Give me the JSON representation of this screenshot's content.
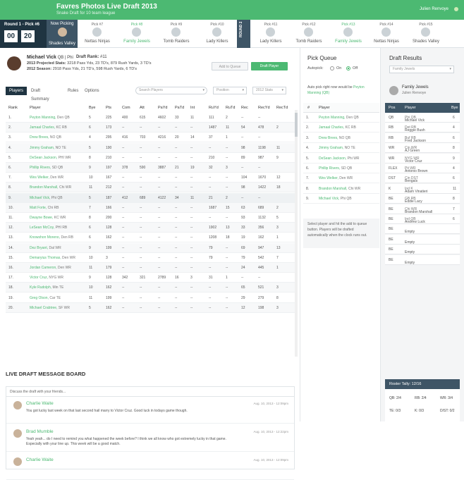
{
  "header": {
    "title": "Favres Photos Live Draft 2013",
    "subtitle": "Snake Draft for 10 team league",
    "user": "Julien Renvoye"
  },
  "round": {
    "label": "Round 1 - Pick #6",
    "clock_min": "00",
    "clock_sec": "20"
  },
  "now_picking": {
    "label": "Now Picking",
    "team": "Shades Valley"
  },
  "picks": [
    {
      "pick": "Pick #7",
      "team": "Nettas Ninjas",
      "green": false
    },
    {
      "pick": "Pick #8",
      "team": "Family Jewels",
      "green": true
    },
    {
      "pick": "Pick #9",
      "team": "Tomb Raiders",
      "green": false
    },
    {
      "pick": "Pick #10",
      "team": "Lady Killers",
      "green": false
    },
    {
      "pick": "Pick #11",
      "team": "Lady Killers",
      "green": false
    },
    {
      "pick": "Pick #12",
      "team": "Tomb Raiders",
      "green": false
    },
    {
      "pick": "Pick #13",
      "team": "Family Jewels",
      "green": true
    },
    {
      "pick": "Pick #14",
      "team": "Nettas Ninjas",
      "green": false
    },
    {
      "pick": "Pick #15",
      "team": "Shades Valley",
      "green": false
    }
  ],
  "round2_label": "ROUND 2",
  "player": {
    "name": "Michael Vick",
    "meta": "QB | Phi",
    "rank_label": "Draft Rank:",
    "rank": "#11",
    "stat1_label": "2013 Projected Stats:",
    "stat1": "3218 Pass Yds, 23 TD's, 879 Rush Yards, 3 TD's",
    "stat2_label": "2012 Season:",
    "stat2": "2918 Pass Yds, 21 TD's, 598 Rush Yards, 6 TD's",
    "add_queue": "Add to Queue",
    "draft_player": "Draft Player"
  },
  "tabs": [
    "Players",
    "Draft Summary",
    "Rules",
    "Options"
  ],
  "search_placeholder": "Search Players",
  "position_select": "Position",
  "stats_select": "2012 Stats",
  "table": {
    "headers": [
      "Rank",
      "Player",
      "Bye",
      "Pts",
      "Com",
      "Att",
      "PaYd",
      "PaTd",
      "Int",
      "RuYd",
      "RuTd",
      "Rec",
      "RecYd",
      "RecTd"
    ],
    "rows": [
      [
        "1.",
        "Peyton Manning,",
        "Den QB",
        "5",
        "225",
        "400",
        "615",
        "4602",
        "33",
        "11",
        "111",
        "2",
        "--",
        "--"
      ],
      [
        "2.",
        "Jamaal Charles,",
        "KC RB",
        "6",
        "173",
        "--",
        "--",
        "--",
        "--",
        "--",
        "1487",
        "11",
        "54",
        "478",
        "2"
      ],
      [
        "3.",
        "Drew Brees,",
        "NO QB",
        "4",
        "295",
        "416",
        "703",
        "4216",
        "20",
        "14",
        "37",
        "1",
        "--",
        "--"
      ],
      [
        "4.",
        "Jimmy Graham,",
        "NO TE",
        "5",
        "190",
        "--",
        "--",
        "--",
        "--",
        "--",
        "--",
        "--",
        "98",
        "1198",
        "11"
      ],
      [
        "5.",
        "DeSean Jackson,",
        "PHI WR",
        "8",
        "210",
        "--",
        "--",
        "--",
        "--",
        "--",
        "210",
        "--",
        "89",
        "987",
        "9"
      ],
      [
        "6.",
        "Phillip Rivers,",
        "SD QB",
        "9",
        "197",
        "378",
        "590",
        "3887",
        "21",
        "19",
        "32",
        "3",
        "--",
        "--"
      ],
      [
        "7.",
        "Wes Welker,",
        "Den WR",
        "10",
        "167",
        "--",
        "--",
        "--",
        "--",
        "--",
        "--",
        "--",
        "104",
        "1670",
        "12"
      ],
      [
        "8.",
        "Brandon Marshall,",
        "Chi WR",
        "11",
        "212",
        "--",
        "--",
        "--",
        "--",
        "--",
        "--",
        "--",
        "98",
        "1422",
        "18"
      ],
      [
        "9.",
        "Michael Vick,",
        "Phi QB",
        "5",
        "187",
        "412",
        "689",
        "4122",
        "34",
        "11",
        "21",
        "2",
        "--",
        "--"
      ],
      [
        "10.",
        "Matt Forte,",
        "Chi RB",
        "7",
        "166",
        "--",
        "--",
        "--",
        "--",
        "--",
        "1687",
        "15",
        "63",
        "689",
        "2"
      ],
      [
        "11.",
        "Dwayne Bowe,",
        "KC WR",
        "8",
        "200",
        "--",
        "--",
        "--",
        "--",
        "--",
        "--",
        "--",
        "93",
        "1132",
        "5"
      ],
      [
        "12.",
        "LeSean McCoy,",
        "PHI RB",
        "6",
        "128",
        "--",
        "--",
        "--",
        "--",
        "--",
        "1902",
        "13",
        "33",
        "356",
        "3"
      ],
      [
        "13.",
        "Knowshon Moreno,",
        "Den RB",
        "6",
        "162",
        "--",
        "--",
        "--",
        "--",
        "--",
        "1208",
        "18",
        "19",
        "162",
        "1"
      ],
      [
        "14.",
        "Dez Bryant,",
        "Dal WR",
        "9",
        "199",
        "--",
        "--",
        "--",
        "--",
        "--",
        "79",
        "--",
        "69",
        "947",
        "13"
      ],
      [
        "15.",
        "Demaryius Thomas,",
        "Den WR",
        "10",
        "3",
        "--",
        "--",
        "--",
        "--",
        "--",
        "79",
        "--",
        "79",
        "542",
        "7"
      ],
      [
        "16.",
        "Jordan Cameron,",
        "Den WR",
        "11",
        "179",
        "--",
        "--",
        "--",
        "--",
        "--",
        "--",
        "--",
        "24",
        "445",
        "1"
      ],
      [
        "17.",
        "Victor Cruz,",
        "NYG WR",
        "9",
        "128",
        "342",
        "321",
        "2789",
        "16",
        "3",
        "31",
        "1",
        "--",
        "--"
      ],
      [
        "18.",
        "Kyle Rudolph,",
        "Min TE",
        "10",
        "162",
        "--",
        "--",
        "--",
        "--",
        "--",
        "--",
        "--",
        "65",
        "521",
        "3"
      ],
      [
        "19.",
        "Greg Olson,",
        "Car TE",
        "11",
        "199",
        "--",
        "--",
        "--",
        "--",
        "--",
        "--",
        "--",
        "29",
        "279",
        "8"
      ],
      [
        "20.",
        "Michael Crabtree,",
        "SF WR",
        "5",
        "162",
        "--",
        "--",
        "--",
        "--",
        "--",
        "--",
        "--",
        "12",
        "198",
        "3"
      ]
    ]
  },
  "message_board": {
    "title": "LIVE DRAFT MESSAGE BOARD",
    "prompt": "Discuss the draft with your friends...",
    "messages": [
      {
        "name": "Charlie Waite",
        "date": "Aug. 10, 2013 - 12:09pm",
        "text": "You got lucky last week on that last second hail marry to Victor Cruz. Good luck in todays game though."
      },
      {
        "name": "Brad Mumble",
        "date": "Aug. 10, 2013 - 12:22pm",
        "text": "Yeah yeah... do I need to remind you what happened the week before? I think we all know who got extremely lucky in that game. Especially with your line up. This week will be a good match."
      },
      {
        "name": "Charlie Waite",
        "date": "Aug. 10, 2013 - 12:09pm",
        "text": ""
      }
    ]
  },
  "pick_queue": {
    "title": "Pick Queue",
    "autopick": "Autopick:",
    "on": "On",
    "off": "Off",
    "note_pre": "Auto pick right now would be",
    "note_player": "Peyton Manning (QB)",
    "col_num": "#",
    "col_player": "Player",
    "items": [
      {
        "n": "1.",
        "name": "Peyton Manning,",
        "meta": "Den QB"
      },
      {
        "n": "2.",
        "name": "Jamaal Charles,",
        "meta": "KC RB"
      },
      {
        "n": "3.",
        "name": "Drew Brees,",
        "meta": "NO QB"
      },
      {
        "n": "4.",
        "name": "Jimmy Graham,",
        "meta": "NO TE"
      },
      {
        "n": "5.",
        "name": "DeSean Jackson,",
        "meta": "Phi WR"
      },
      {
        "n": "6.",
        "name": "Phillip Rivers,",
        "meta": "SD QB"
      },
      {
        "n": "7.",
        "name": "Wes Welker,",
        "meta": "Den WR"
      },
      {
        "n": "8.",
        "name": "Brandon Marshall,",
        "meta": "Chi WR"
      },
      {
        "n": "9.",
        "name": "Michael Vick,",
        "meta": "Phi QB"
      }
    ],
    "help": "Select player and hit the add to queue button. Players will be drafted automatically when the clock runs out."
  },
  "draft_results": {
    "title": "Draft Results",
    "select": "Family Jewels",
    "team": "Family Jewels",
    "owner": "Julien Renvoye",
    "headers": [
      "Pos",
      "Player",
      "Bye"
    ],
    "rows": [
      {
        "pos": "QB",
        "name": "Michael Vick",
        "meta": "Phi QB",
        "bye": "6"
      },
      {
        "pos": "RB",
        "name": "Reggie Bush",
        "meta": "Det RB",
        "bye": "4"
      },
      {
        "pos": "RB",
        "name": "Fred Jackson",
        "meta": "Buf RB",
        "bye": "6"
      },
      {
        "pos": "WR",
        "name": "AJ Green",
        "meta": "Cin WR",
        "bye": "8"
      },
      {
        "pos": "WR",
        "name": "Victor Cruz",
        "meta": "NYG WR",
        "bye": "9"
      },
      {
        "pos": "FLEX",
        "name": "Antonio Brown",
        "meta": "Pit WR",
        "bye": "4"
      },
      {
        "pos": "DST",
        "name": "Bengals",
        "meta": "Cin DST",
        "bye": "6"
      },
      {
        "pos": "K",
        "name": "Adam Vinatieri",
        "meta": "Ind K",
        "bye": "11"
      },
      {
        "pos": "BE",
        "name": "Eddie Lacy",
        "meta": "GB RB",
        "bye": "8"
      },
      {
        "pos": "BE",
        "name": "Brandon Marshall",
        "meta": "Chi WR",
        "bye": "7"
      },
      {
        "pos": "BE",
        "name": "Andrew Luck",
        "meta": "Ind QB",
        "bye": "6"
      },
      {
        "pos": "BE",
        "name": "Empty",
        "meta": "",
        "bye": ""
      },
      {
        "pos": "BE",
        "name": "Empty",
        "meta": "",
        "bye": ""
      },
      {
        "pos": "BE",
        "name": "Empty",
        "meta": "",
        "bye": ""
      },
      {
        "pos": "BE",
        "name": "Empty",
        "meta": "",
        "bye": ""
      }
    ],
    "tally_title": "Roster Tally: 12/16",
    "tally": [
      "QB: 2/4",
      "RB: 2/4",
      "WR: 3/4",
      "TE: 0/3",
      "K: 0/3",
      "D/ST: 0/2"
    ]
  }
}
